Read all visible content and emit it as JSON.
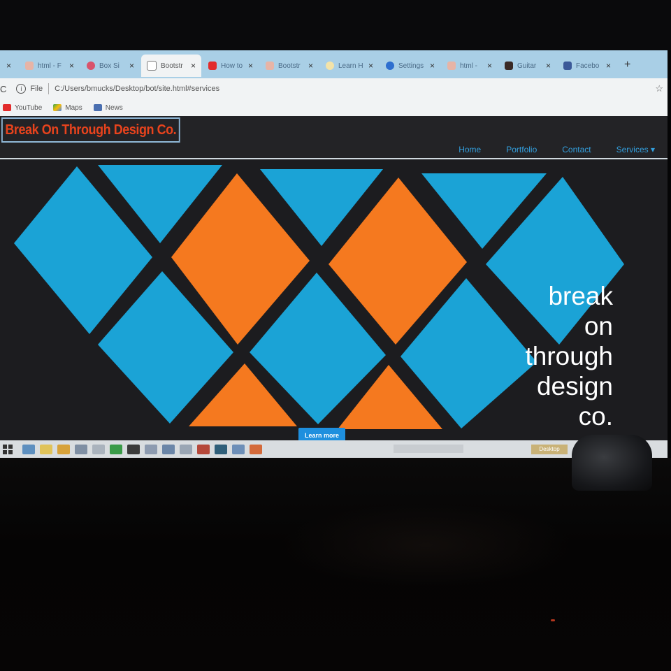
{
  "browser": {
    "tabs": [
      {
        "label": "html - F",
        "icon": "html-icon",
        "active": false
      },
      {
        "label": "Box Si",
        "icon": "box-icon",
        "active": false
      },
      {
        "label": "Bootstr",
        "icon": "page-icon",
        "active": true
      },
      {
        "label": "How to",
        "icon": "youtube-icon",
        "active": false
      },
      {
        "label": "Bootstr",
        "icon": "html-icon",
        "active": false
      },
      {
        "label": "Learn H",
        "icon": "learn-icon",
        "active": false
      },
      {
        "label": "Settings",
        "icon": "gear-icon",
        "active": false
      },
      {
        "label": "html - ",
        "icon": "html-icon",
        "active": false
      },
      {
        "label": "Guitar",
        "icon": "guitar-icon",
        "active": false
      },
      {
        "label": "Facebo",
        "icon": "facebook-icon",
        "active": false
      }
    ],
    "close_glyph": "×",
    "new_tab": "+",
    "address": {
      "scheme_label": "File",
      "url": "C:/Users/bmucks/Desktop/bot/site.html#services"
    },
    "bookmarks": [
      {
        "label": "YouTube",
        "icon": "youtube-icon"
      },
      {
        "label": "Maps",
        "icon": "maps-icon"
      },
      {
        "label": "News",
        "icon": "news-icon"
      }
    ]
  },
  "site": {
    "brand": "Break On Through Design Co.",
    "nav": [
      "Home",
      "Portfolio",
      "Contact",
      "Services ▾"
    ],
    "tagline": [
      "break",
      "on",
      "through",
      "design",
      "co."
    ],
    "cta": "Learn more"
  },
  "taskbar": {
    "button_label": "Desktop"
  },
  "colors": {
    "accent_blue": "#1ba3d6",
    "accent_orange": "#f5791f",
    "brand_red": "#e8431d",
    "link_blue": "#33a0df",
    "page_bg": "#1c1c1f"
  }
}
